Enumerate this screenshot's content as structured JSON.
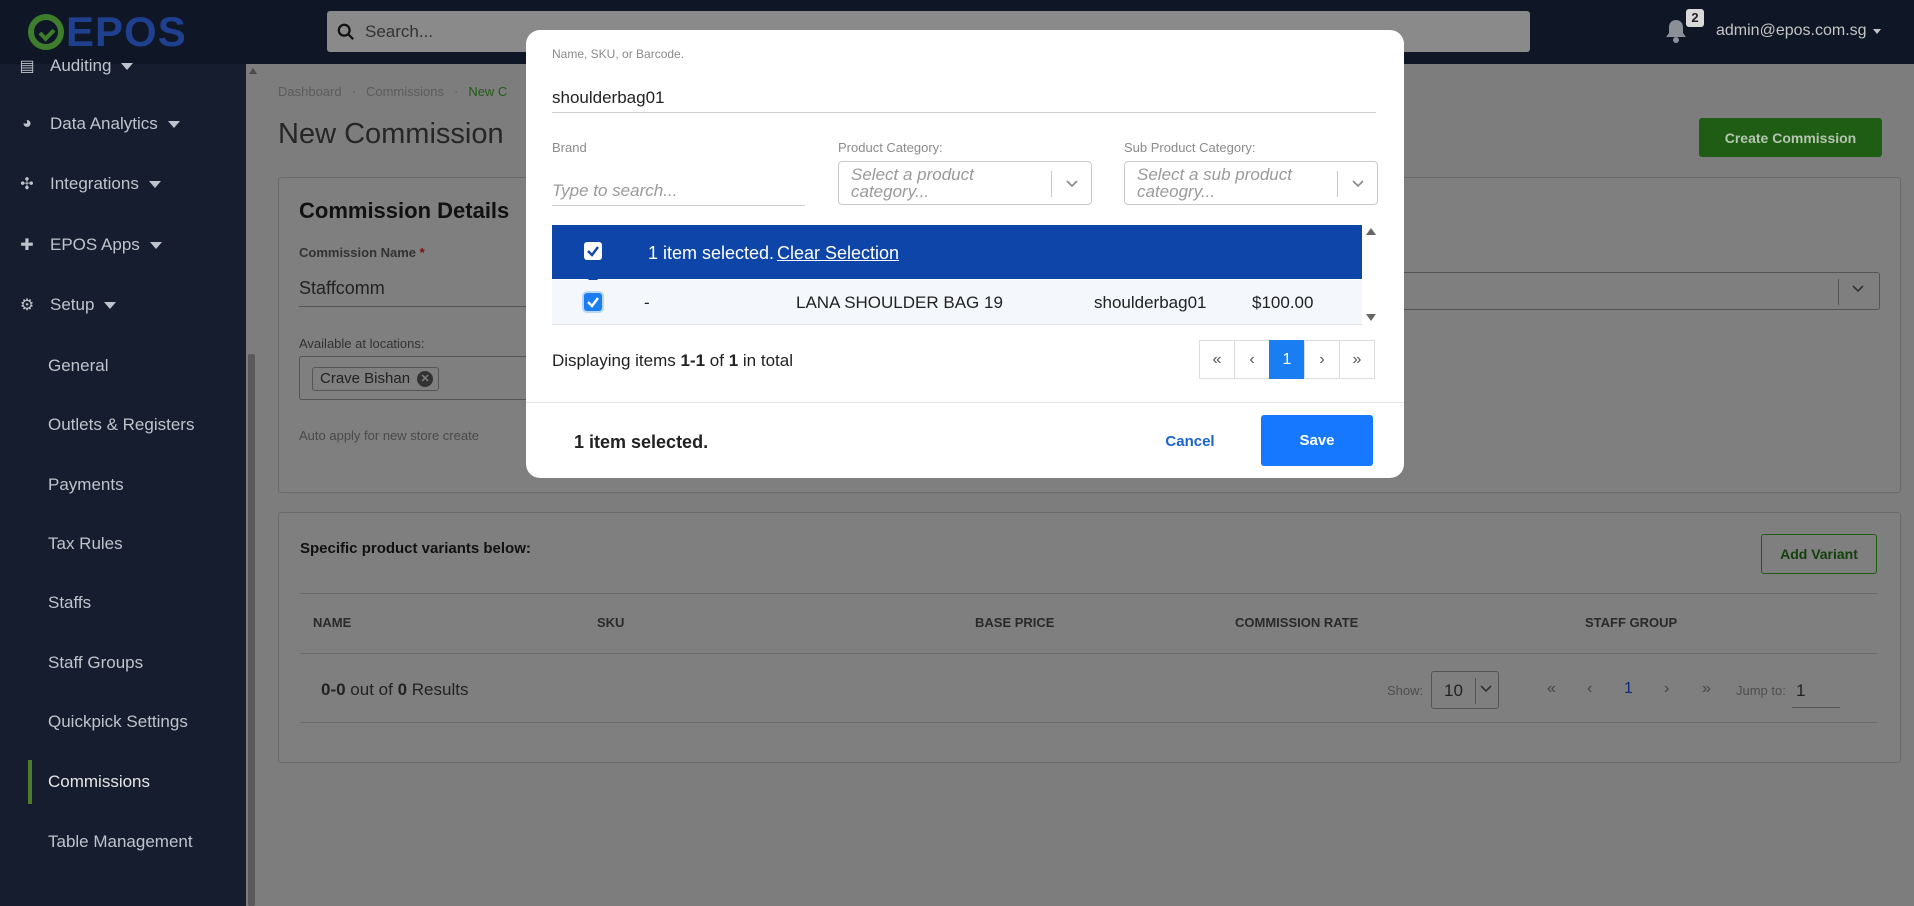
{
  "brand": {
    "logo_text": "EPOS"
  },
  "topbar": {
    "search_placeholder": "Search...",
    "notification_count": "2",
    "user_email": "admin@epos.com.sg"
  },
  "sidebar": {
    "groups": [
      {
        "label": "Auditing",
        "icon": "clipboard-icon"
      },
      {
        "label": "Data Analytics",
        "icon": "pie-chart-icon"
      },
      {
        "label": "Integrations",
        "icon": "puzzle-icon"
      },
      {
        "label": "EPOS Apps",
        "icon": "plus-icon"
      },
      {
        "label": "Setup",
        "icon": "gear-icon"
      }
    ],
    "setup_items": [
      {
        "label": "General"
      },
      {
        "label": "Outlets & Registers"
      },
      {
        "label": "Payments"
      },
      {
        "label": "Tax Rules"
      },
      {
        "label": "Staffs"
      },
      {
        "label": "Staff Groups"
      },
      {
        "label": "Quickpick Settings"
      },
      {
        "label": "Commissions",
        "active": true
      },
      {
        "label": "Table Management"
      }
    ]
  },
  "page": {
    "breadcrumb": [
      "Dashboard",
      "Commissions",
      "New C"
    ],
    "title": "New Commission",
    "create_button": "Create Commission",
    "details": {
      "title": "Commission Details",
      "name_label": "Commission Name",
      "required_mark": "*",
      "name_value": "Staffcomm",
      "locations_label": "Available at locations:",
      "location_chip": "Crave Bishan",
      "auto_apply_label": "Auto apply for new store create"
    },
    "variants": {
      "title": "Specific product variants below:",
      "add_button": "Add Variant",
      "columns": [
        "NAME",
        "SKU",
        "BASE PRICE",
        "COMMISSION RATE",
        "STAFF GROUP"
      ],
      "results_range": "0-0",
      "results_of": " out of ",
      "results_total": "0",
      "results_suffix": " Results",
      "show_label": "Show:",
      "show_value": "10",
      "pager": [
        "«",
        "‹",
        "1",
        "›",
        "»"
      ],
      "jump_label": "Jump to:",
      "jump_value": "1"
    }
  },
  "modal": {
    "search_label": "Name, SKU, or Barcode.",
    "search_value": "shoulderbag01",
    "brand_label": "Brand",
    "brand_placeholder": "Type to search...",
    "category_label": "Product Category:",
    "category_placeholder": "Select a product category...",
    "subcategory_label": "Sub Product Category:",
    "subcategory_placeholder": "Select a sub product cateogry...",
    "selection_text": "1 item selected.",
    "clear_selection": "Clear Selection",
    "row": {
      "col1": "-",
      "name": "LANA SHOULDER BAG 19",
      "sku": "shoulderbag01",
      "price": "$100.00"
    },
    "display_prefix": "Displaying items ",
    "display_range": "1-1",
    "display_of": " of ",
    "display_total": "1",
    "display_suffix": " in total",
    "pager": [
      "«",
      "‹",
      "1",
      "›",
      "»"
    ],
    "footer_selected": "1 item selected.",
    "cancel_label": "Cancel",
    "save_label": "Save"
  },
  "colors": {
    "topbar_bg": "#0f1626",
    "selection_bar": "#0e45a8",
    "primary_button": "#1677ff",
    "create_button": "#1f5d15"
  }
}
